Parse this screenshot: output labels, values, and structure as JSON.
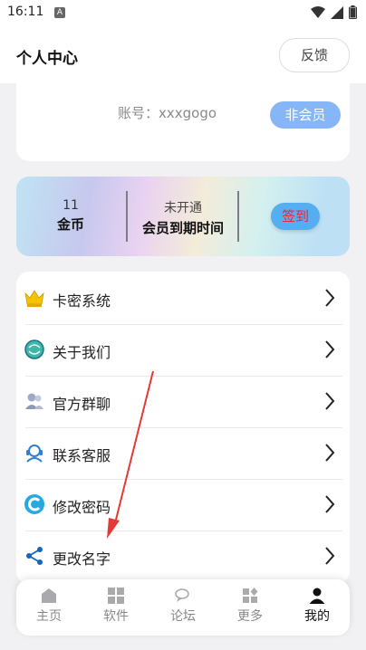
{
  "status_bar": {
    "time": "16:11",
    "notification_icon": "A"
  },
  "header": {
    "title": "个人中心",
    "feedback_label": "反馈"
  },
  "account": {
    "text": "账号：xxxgogo",
    "vip_badge": "非会员"
  },
  "vip_banner": {
    "coins_value": "11",
    "coins_label": "金币",
    "expiry_status": "未开通",
    "expiry_label": "会员到期时间",
    "sign_in_label": "签到"
  },
  "menu": {
    "items": [
      {
        "label": "卡密系统",
        "icon": "crown-icon"
      },
      {
        "label": "关于我们",
        "icon": "info-globe-icon"
      },
      {
        "label": "官方群聊",
        "icon": "group-chat-icon"
      },
      {
        "label": "联系客服",
        "icon": "headset-icon"
      },
      {
        "label": "修改密码",
        "icon": "password-icon"
      },
      {
        "label": "更改名字",
        "icon": "share-icon"
      }
    ]
  },
  "bottom_nav": {
    "items": [
      {
        "label": "主页",
        "icon": "home-icon"
      },
      {
        "label": "软件",
        "icon": "apps-icon"
      },
      {
        "label": "论坛",
        "icon": "forum-icon"
      },
      {
        "label": "更多",
        "icon": "more-icon"
      },
      {
        "label": "我的",
        "icon": "profile-icon",
        "active": true
      }
    ]
  },
  "colors": {
    "accent": "#86b6f5",
    "sign_in_bg": "#55aef0",
    "sign_in_text": "#e8233a",
    "annotation_arrow": "#e53935"
  }
}
